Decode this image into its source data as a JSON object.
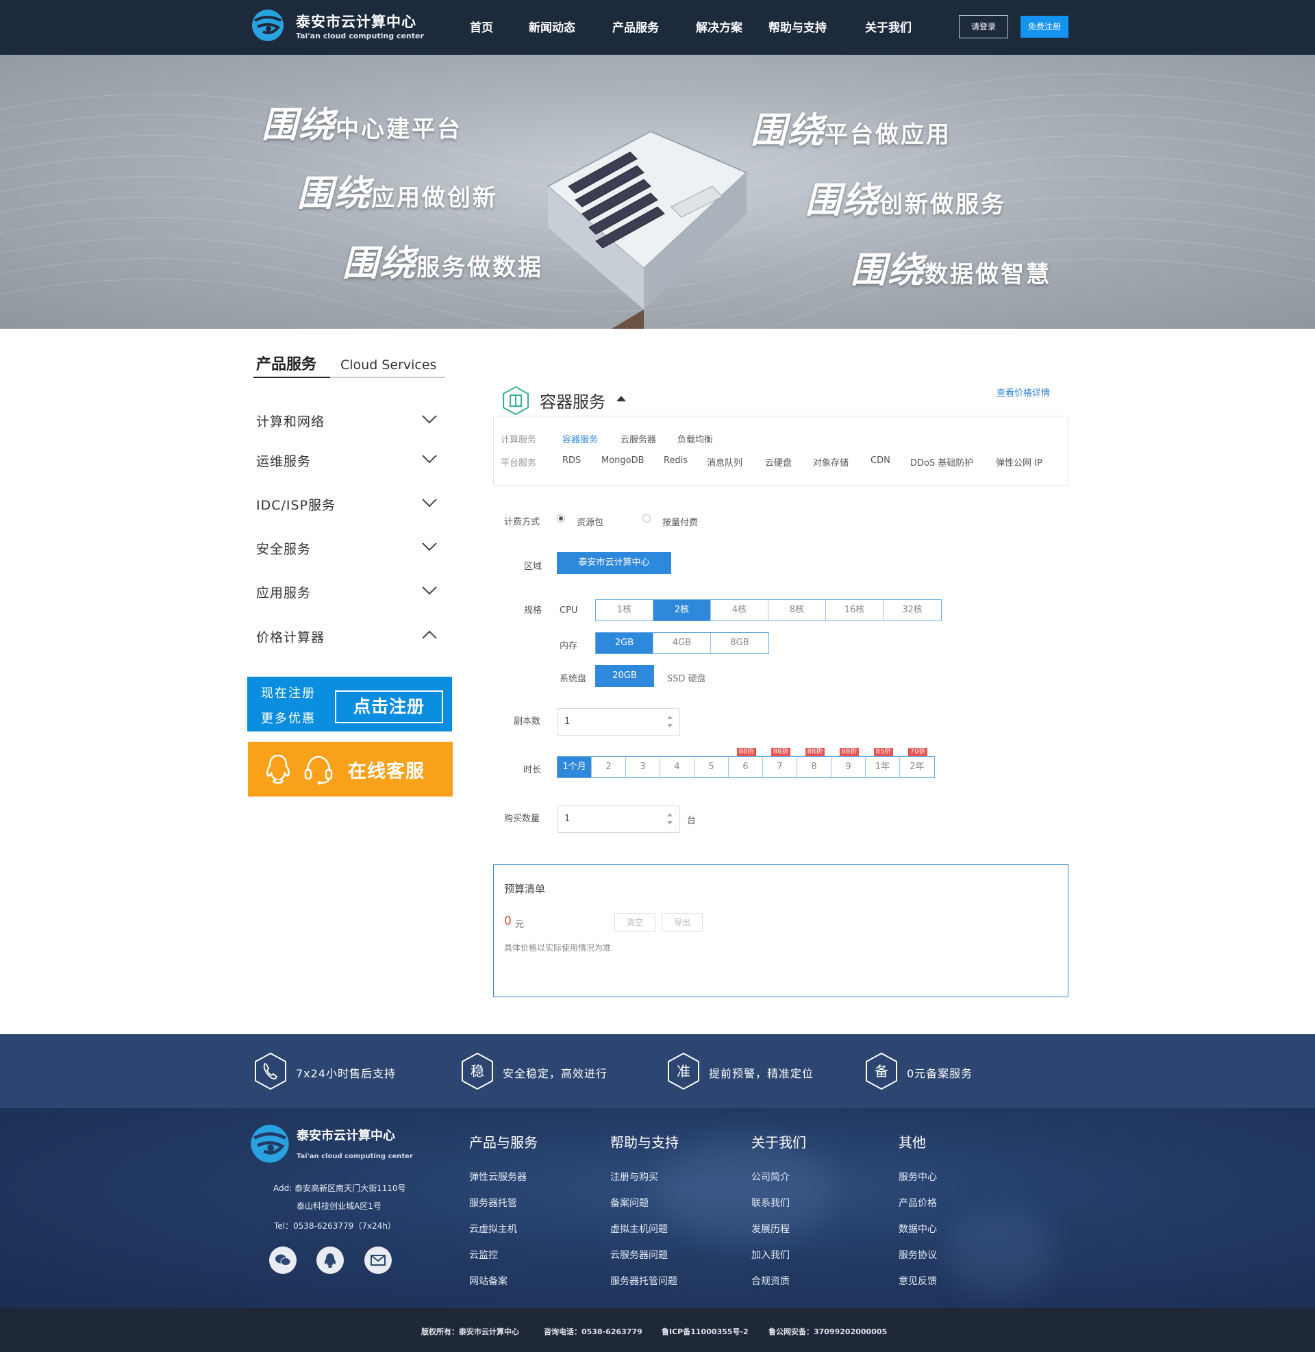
{
  "header": {
    "logo_title": "泰安市云计算中心",
    "logo_subtitle": "Tai'an cloud computing center",
    "nav": [
      "首页",
      "新闻动态",
      "产品服务",
      "解决方案",
      "帮助与支持",
      "关于我们"
    ],
    "login": "请登录",
    "signup": "免费注册"
  },
  "banner": {
    "slogans": [
      {
        "big": "围绕",
        "small": "中心建平台"
      },
      {
        "big": "围绕",
        "small": "应用做创新"
      },
      {
        "big": "围绕",
        "small": "服务做数据"
      },
      {
        "big": "围绕",
        "small": "平台做应用"
      },
      {
        "big": "围绕",
        "small": "创新做服务"
      },
      {
        "big": "围绕",
        "small": "数据做智慧"
      }
    ]
  },
  "sidebar": {
    "title_cn": "产品服务",
    "title_en": "Cloud Services",
    "items": [
      "计算和网络",
      "运维服务",
      "IDC/ISP服务",
      "安全服务",
      "应用服务",
      "价格计算器"
    ],
    "promo_line1": "现在注册",
    "promo_line2": "更多优惠",
    "promo_button": "点击注册",
    "support": "在线客服"
  },
  "main": {
    "service_title": "容器服务",
    "price_link": "查看价格详情",
    "tabs_row1": {
      "head": "计算服务",
      "items": [
        "容器服务",
        "云服务器",
        "负载均衡"
      ],
      "active": "容器服务"
    },
    "tabs_row2": {
      "head": "平台服务",
      "items": [
        "RDS",
        "MongoDB",
        "Redis",
        "消息队列",
        "云硬盘",
        "对象存储",
        "CDN",
        "DDoS 基础防护",
        "弹性公网 IP"
      ]
    },
    "billing": {
      "label": "计费方式",
      "options": [
        "资源包",
        "按量付费"
      ],
      "selected": "资源包"
    },
    "region": {
      "label": "区域",
      "value": "泰安市云计算中心"
    },
    "spec": {
      "label": "规格",
      "cpu_label": "CPU",
      "cpu": [
        "1核",
        "2核",
        "4核",
        "8核",
        "16核",
        "32核"
      ],
      "cpu_selected": "2核",
      "mem_label": "内存",
      "mem": [
        "2GB",
        "4GB",
        "8GB"
      ],
      "mem_selected": "2GB",
      "disk_label": "系统盘",
      "disk": "20GB",
      "ssd": "SSD 硬盘"
    },
    "replicas": {
      "label": "副本数",
      "value": "1"
    },
    "duration": {
      "label": "时长",
      "options": [
        {
          "v": "1个月",
          "d": ""
        },
        {
          "v": "2",
          "d": ""
        },
        {
          "v": "3",
          "d": ""
        },
        {
          "v": "4",
          "d": ""
        },
        {
          "v": "5",
          "d": ""
        },
        {
          "v": "6",
          "d": "88折"
        },
        {
          "v": "7",
          "d": "88折"
        },
        {
          "v": "8",
          "d": "88折"
        },
        {
          "v": "9",
          "d": "88折"
        },
        {
          "v": "1年",
          "d": "85折"
        },
        {
          "v": "2年",
          "d": "70折"
        }
      ],
      "selected": "1个月"
    },
    "quantity": {
      "label": "购买数量",
      "value": "1",
      "unit": "台"
    },
    "budget": {
      "title": "预算清单",
      "amount": "0",
      "currency": "元",
      "clear": "清空",
      "export": "导出",
      "note": "具体价格以实际使用情况为准"
    }
  },
  "features": [
    {
      "icon": "phone-icon",
      "text": "7x24小时售后支持"
    },
    {
      "icon": "稳",
      "text": "安全稳定，高效进行"
    },
    {
      "icon": "准",
      "text": "提前预警，精准定位"
    },
    {
      "icon": "备",
      "text": "0元备案服务"
    }
  ],
  "footer": {
    "logo_title": "泰安市云计算中心",
    "logo_subtitle": "Tai'an cloud computing center",
    "addr1": "Add: 泰安高新区南天门大街1110号",
    "addr2": "泰山科技创业城A区1号",
    "tel": "Tel：0538-6263779（7x24h）",
    "columns": [
      {
        "title": "产品与服务",
        "items": [
          "弹性云服务器",
          "服务器托管",
          "云虚拟主机",
          "云监控",
          "网站备案"
        ]
      },
      {
        "title": "帮助与支持",
        "items": [
          "注册与购买",
          "备案问题",
          "虚拟主机问题",
          "云服务器问题",
          "服务器托管问题"
        ]
      },
      {
        "title": "关于我们",
        "items": [
          "公司简介",
          "联系我们",
          "发展历程",
          "加入我们",
          "合规资质"
        ]
      },
      {
        "title": "其他",
        "items": [
          "服务中心",
          "产品价格",
          "数据中心",
          "服务协议",
          "意见反馈"
        ]
      }
    ],
    "copyright": "版权所有：泰安市云计算中心",
    "hotline": "咨询电话：0538-6263779",
    "icp": "鲁ICP备11000355号-2",
    "police": "鲁公网安备：37099202000005"
  }
}
